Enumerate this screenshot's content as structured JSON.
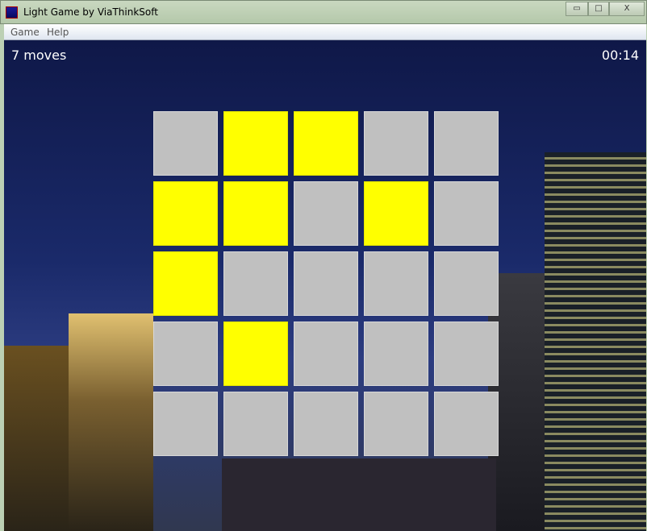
{
  "window": {
    "title": "Light Game by ViaThinkSoft",
    "minimize": "▭",
    "maximize": "□",
    "close": "X"
  },
  "menu": [
    "Game",
    "Help"
  ],
  "status": {
    "moves": "7 moves",
    "timer": "00:14"
  },
  "colors": {
    "on": "#ffff00",
    "off": "#c0c0c0"
  },
  "board": [
    [
      0,
      1,
      1,
      0,
      0
    ],
    [
      1,
      1,
      0,
      1,
      0
    ],
    [
      1,
      0,
      0,
      0,
      0
    ],
    [
      0,
      1,
      0,
      0,
      0
    ],
    [
      0,
      0,
      0,
      0,
      0
    ]
  ]
}
